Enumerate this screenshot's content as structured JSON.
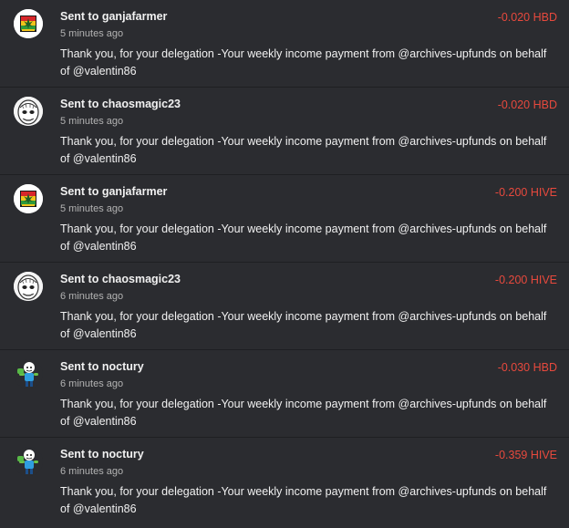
{
  "transactions": [
    {
      "action": "Sent to",
      "recipient": "ganjafarmer",
      "time": "5 minutes ago",
      "amount": "-0.020 HBD",
      "memo": "Thank you, for your delegation -Your weekly income payment from @archives-upfunds on behalf of @valentin86",
      "avatar_icon": "ganjafarmer-avatar-icon"
    },
    {
      "action": "Sent to",
      "recipient": "chaosmagic23",
      "time": "5 minutes ago",
      "amount": "-0.020 HBD",
      "memo": "Thank you, for your delegation -Your weekly income payment from @archives-upfunds on behalf of @valentin86",
      "avatar_icon": "chaosmagic23-avatar-icon"
    },
    {
      "action": "Sent to",
      "recipient": "ganjafarmer",
      "time": "5 minutes ago",
      "amount": "-0.200 HIVE",
      "memo": "Thank you, for your delegation -Your weekly income payment from @archives-upfunds on behalf of @valentin86",
      "avatar_icon": "ganjafarmer-avatar-icon"
    },
    {
      "action": "Sent to",
      "recipient": "chaosmagic23",
      "time": "6 minutes ago",
      "amount": "-0.200 HIVE",
      "memo": "Thank you, for your delegation -Your weekly income payment from @archives-upfunds on behalf of @valentin86",
      "avatar_icon": "chaosmagic23-avatar-icon"
    },
    {
      "action": "Sent to",
      "recipient": "noctury",
      "time": "6 minutes ago",
      "amount": "-0.030 HBD",
      "memo": "Thank you, for your delegation -Your weekly income payment from @archives-upfunds on behalf of @valentin86",
      "avatar_icon": "noctury-avatar-icon"
    },
    {
      "action": "Sent to",
      "recipient": "noctury",
      "time": "6 minutes ago",
      "amount": "-0.359 HIVE",
      "memo": "Thank you, for your delegation -Your weekly income payment from @archives-upfunds on behalf of @valentin86",
      "avatar_icon": "noctury-avatar-icon"
    }
  ],
  "colors": {
    "background": "#2b2c30",
    "text": "#f1f1f1",
    "muted": "#b3b3b3",
    "negative_amount": "#e8493d"
  }
}
